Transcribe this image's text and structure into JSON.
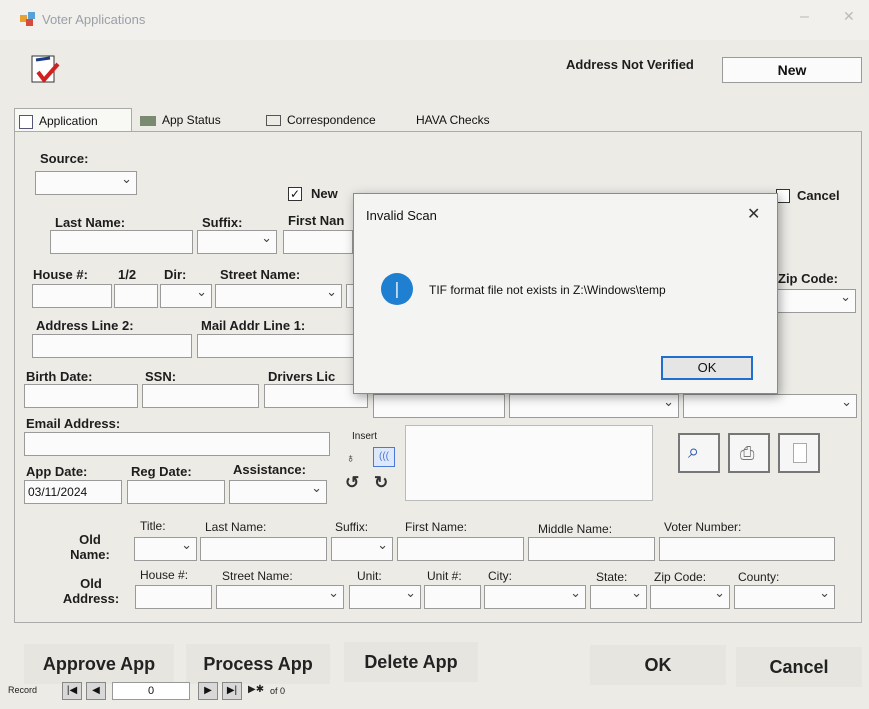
{
  "window": {
    "title": "Voter Applications"
  },
  "header": {
    "address_status": "Address Not Verified",
    "status_value": "New"
  },
  "tabs": [
    {
      "label": "Application"
    },
    {
      "label": "App Status"
    },
    {
      "label": "Correspondence"
    },
    {
      "label": "HAVA Checks"
    }
  ],
  "form": {
    "source_label": "Source:",
    "checks": {
      "new": "New",
      "cancel": "Cancel"
    },
    "last_name": "Last Name:",
    "suffix": "Suffix:",
    "first_name": "First Nan",
    "house": "House #:",
    "half": "1/2",
    "dir": "Dir:",
    "street_name": "Street Name:",
    "zip_code": "Zip Code:",
    "address_line2": "Address Line 2:",
    "mail_addr1": "Mail Addr Line 1:",
    "birth_date": "Birth Date:",
    "ssn": "SSN:",
    "drivers_lic": "Drivers Lic",
    "email": "Email Address:",
    "insert": "Insert",
    "app_date": "App Date:",
    "reg_date": "Reg Date:",
    "assistance": "Assistance:",
    "app_date_value": "03/11/2024"
  },
  "old": {
    "name_label": "Old Name:",
    "address_label": "Old Address:",
    "title": "Title:",
    "last_name": "Last Name:",
    "suffix": "Suffix:",
    "first_name": "First Name:",
    "middle_name": "Middle Name:",
    "voter_number": "Voter Number:",
    "house": "House #:",
    "street_name": "Street Name:",
    "unit": "Unit:",
    "unit_no": "Unit #:",
    "city": "City:",
    "state": "State:",
    "zip_code": "Zip Code:",
    "county": "County:"
  },
  "buttons": {
    "approve": "Approve App",
    "process": "Process App",
    "delete": "Delete App",
    "ok": "OK",
    "cancel": "Cancel"
  },
  "record_nav": {
    "label": "Record",
    "value": "0",
    "of": "of 0"
  },
  "dialog": {
    "title": "Invalid Scan",
    "message": "TIF format file not exists in Z:\\Windows\\temp",
    "ok": "OK",
    "close": "✕"
  }
}
